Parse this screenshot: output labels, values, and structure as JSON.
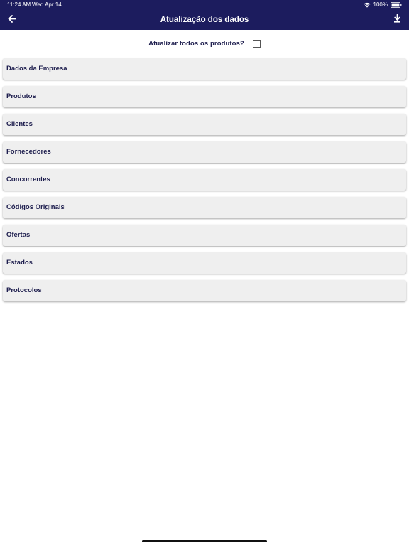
{
  "status_bar": {
    "time": "11:24 AM",
    "date": "Wed Apr 14",
    "battery": "100%",
    "icons": [
      "wifi-icon",
      "battery-icon"
    ]
  },
  "header": {
    "title": "Atualização dos dados",
    "back_icon": "arrow-left-icon",
    "download_icon": "download-icon"
  },
  "update_all": {
    "label": "Atualizar todos os produtos?",
    "checked": false
  },
  "sections": [
    {
      "label": "Dados da Empresa"
    },
    {
      "label": "Produtos"
    },
    {
      "label": "Clientes"
    },
    {
      "label": "Fornecedores"
    },
    {
      "label": "Concorrentes"
    },
    {
      "label": "Códigos Originais"
    },
    {
      "label": "Ofertas"
    },
    {
      "label": "Estados"
    },
    {
      "label": "Protocolos"
    }
  ],
  "colors": {
    "header_background": "#1c1c5e",
    "item_background": "#efefef",
    "item_text": "#1e1e4e"
  }
}
